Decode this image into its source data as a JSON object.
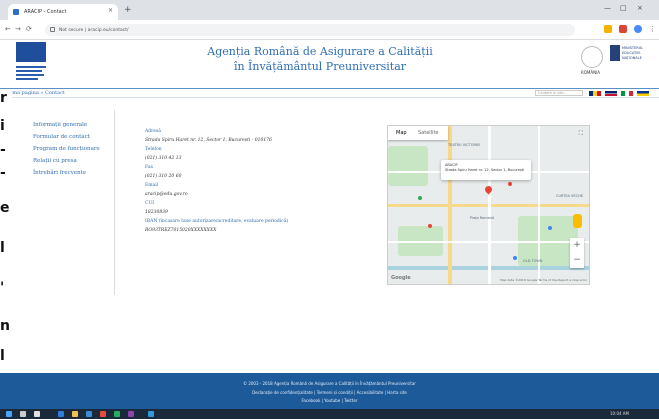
{
  "browser": {
    "tab_title": "ARACIP - Contact",
    "tab_close": "×",
    "new_tab": "+",
    "url": "Not secure | aracip.eu/contact/",
    "win_min": "—",
    "win_max": "□",
    "win_close": "×"
  },
  "header": {
    "title_line1": "Agenția Română de Asigurare a Calității",
    "title_line2": "în Învățământul Preuniversitar",
    "logo_left_caption": "ARACIP",
    "romania_caption": "ROMÂNIA",
    "ministry_caption": "MINISTERUL EDUCAȚIEI NAȚIONALE"
  },
  "breadcrumb": "Prima pagina » Contact",
  "search_placeholder": "Cautare in site...",
  "left_strip_chars": [
    "r",
    "i",
    "-",
    "-",
    "e",
    "l",
    "'",
    "n",
    "l"
  ],
  "sidebar": {
    "items": [
      "Informații generale",
      "Formular de contact",
      "Program de funcționare",
      "Relații cu presa",
      "Întrebări frecvente"
    ]
  },
  "contact": {
    "address_label": "Adresă",
    "address_value": "Strada Spiru Haret nr. 12, Sector 1, București - 010176",
    "phone_label": "Telefon",
    "phone_value": "(021) 310 42 13",
    "fax_label": "Fax",
    "fax_value": "(021) 310 20 60",
    "email_label": "Email",
    "email_value": "aracip@edu.gov.ro",
    "cui_label": "CUI",
    "cui_value": "18230839",
    "iban_label": "IBAN (încasare taxe autorizare/acreditare, evaluare periodică)",
    "iban_value": "RO93TREZ7015020XXXXXXXX"
  },
  "map": {
    "tab_map": "Map",
    "tab_satellite": "Satellite",
    "fullscreen": "⛶",
    "info_title": "ARACIP",
    "info_addr": "Strada Spiru Haret nr. 12, Sector 1, București",
    "zoom_in": "+",
    "zoom_out": "−",
    "google": "Google",
    "attribution": "Map data ©2018 Google  Terms of Use  Report a map error",
    "labels": [
      "TEATRU VICTORIEI",
      "CURTEA VECHE",
      "OLD TOWN",
      "Piața Romană"
    ]
  },
  "footer": {
    "line1": "© 2003 - 2018 Agenția Română de Asigurare a Calității în Învățământul Preuniversitar",
    "line2": "Declarație de confidențialitate | Termeni și condiții | Accesibilitate | Harta site",
    "line3": "Facebook | Youtube | Twitter"
  },
  "taskbar": {
    "time": "10:04 AM"
  }
}
